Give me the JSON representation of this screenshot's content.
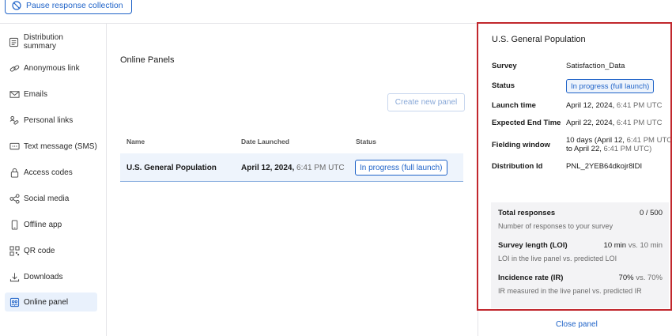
{
  "toolbar": {
    "pause_label": "Pause response collection"
  },
  "sidebar": {
    "items": [
      {
        "label": "Distribution summary",
        "icon": "summary-icon"
      },
      {
        "label": "Anonymous link",
        "icon": "link-icon"
      },
      {
        "label": "Emails",
        "icon": "email-icon"
      },
      {
        "label": "Personal links",
        "icon": "personal-link-icon"
      },
      {
        "label": "Text message (SMS)",
        "icon": "sms-icon"
      },
      {
        "label": "Access codes",
        "icon": "lock-icon"
      },
      {
        "label": "Social media",
        "icon": "share-icon"
      },
      {
        "label": "Offline app",
        "icon": "phone-icon"
      },
      {
        "label": "QR code",
        "icon": "qr-code-icon"
      },
      {
        "label": "Downloads",
        "icon": "download-icon"
      },
      {
        "label": "Online panel",
        "icon": "panel-icon",
        "active": true
      }
    ]
  },
  "main": {
    "title": "Online Panels",
    "create_label": "Create new panel",
    "columns": [
      "Name",
      "Date Launched",
      "Status"
    ],
    "rows": [
      {
        "name": "U.S. General Population",
        "date": "April 12, 2024,",
        "time": "6:41 PM UTC",
        "status": "In progress (full launch)"
      }
    ]
  },
  "panel": {
    "title": "U.S. General Population",
    "survey_label": "Survey",
    "survey_value": "Satisfaction_Data",
    "status_label": "Status",
    "status_value": "In progress (full launch)",
    "launch_label": "Launch time",
    "launch_date": "April 12, 2024,",
    "launch_time": "6:41 PM UTC",
    "end_label": "Expected End Time",
    "end_date": "April 22, 2024,",
    "end_time": "6:41 PM UTC",
    "fielding_label": "Fielding window",
    "fielding_a": "10 days (April 12,",
    "fielding_a_time": "6:41 PM UTC",
    "fielding_b": "to April 22,",
    "fielding_b_time": "6:41 PM UTC)",
    "dist_label": "Distribution Id",
    "dist_value": "PNL_2YEB64dkojr8lDI",
    "total_label": "Total responses",
    "total_value": "0 / 500",
    "total_sub": "Number of responses to your survey",
    "loi_label": "Survey length (LOI)",
    "loi_value": "10 min",
    "loi_vs": "vs. 10 min",
    "loi_sub": "LOI in the live panel vs. predicted LOI",
    "ir_label": "Incidence rate (IR)",
    "ir_value": "70%",
    "ir_vs": "vs. 70%",
    "ir_sub": "IR measured in the live panel vs. predicted IR",
    "close_label": "Close panel"
  },
  "colors": {
    "accent": "#1f63c8",
    "highlight": "#c1272d",
    "active_bg": "#e9f1fc"
  }
}
